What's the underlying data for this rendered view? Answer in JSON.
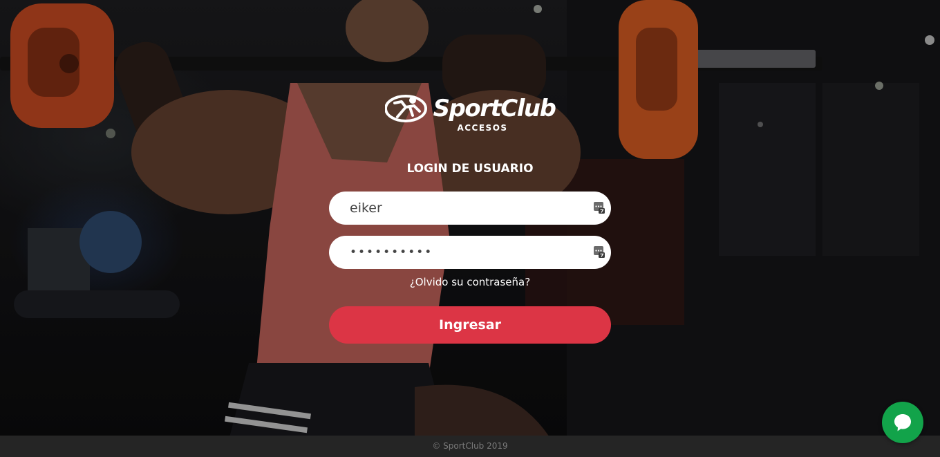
{
  "brand": {
    "logo_text": "SportClub",
    "subtitle": "ACCESOS"
  },
  "login": {
    "title": "LOGIN DE USUARIO",
    "username_value": "eiker",
    "password_value": "••••••••••",
    "forgot_link": "¿Olvido su contraseña?",
    "submit_label": "Ingresar"
  },
  "footer": {
    "copyright": "© SportClub 2019"
  },
  "icons": {
    "username_field_icon": "keyboard-icon",
    "password_field_icon": "keyboard-icon",
    "chat_icon": "chat-bubble-icon"
  },
  "colors": {
    "primary_button": "#dc3545",
    "chat_button": "#12a34a",
    "footer_bg": "#252525"
  }
}
